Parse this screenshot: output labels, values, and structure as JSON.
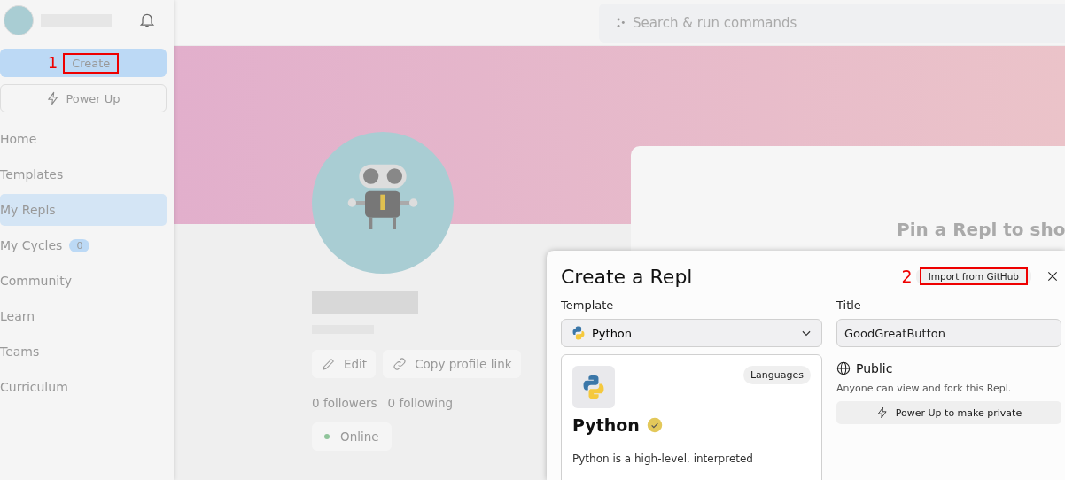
{
  "sidebar": {
    "buttons": [
      {
        "kind": "create",
        "label": "Create",
        "annotation": "1"
      },
      {
        "kind": "power",
        "label": "Power Up"
      }
    ],
    "nav": [
      {
        "label": "Home",
        "selected": false
      },
      {
        "label": "Templates",
        "selected": false
      },
      {
        "label": "My Repls",
        "selected": true
      },
      {
        "label": "My Cycles",
        "selected": false,
        "badge": "0"
      },
      {
        "label": "Community",
        "selected": false
      },
      {
        "label": "Learn",
        "selected": false
      },
      {
        "label": "Teams",
        "selected": false
      },
      {
        "label": "Curriculum",
        "selected": false
      }
    ]
  },
  "search": {
    "placeholder": "Search & run commands"
  },
  "profile": {
    "actions": [
      {
        "kind": "edit",
        "label": "Edit"
      },
      {
        "kind": "link",
        "label": "Copy profile link"
      }
    ],
    "followers": "0 followers",
    "following": "0 following",
    "status": "Online"
  },
  "pin_card": {
    "text": "Pin a Repl to sho"
  },
  "modal": {
    "title": "Create a Repl",
    "import_button": "Import from GitHub",
    "annotation": "2",
    "template_label": "Template",
    "template_value": "Python",
    "template_card": {
      "tag": "Languages",
      "name": "Python",
      "verified": true,
      "description": "Python is a high-level, interpreted"
    },
    "title_label": "Title",
    "title_value": "GoodGreatButton",
    "visibility": "Public",
    "visibility_note": "Anyone can view and fork this Repl.",
    "power_button": "Power Up to make private"
  }
}
